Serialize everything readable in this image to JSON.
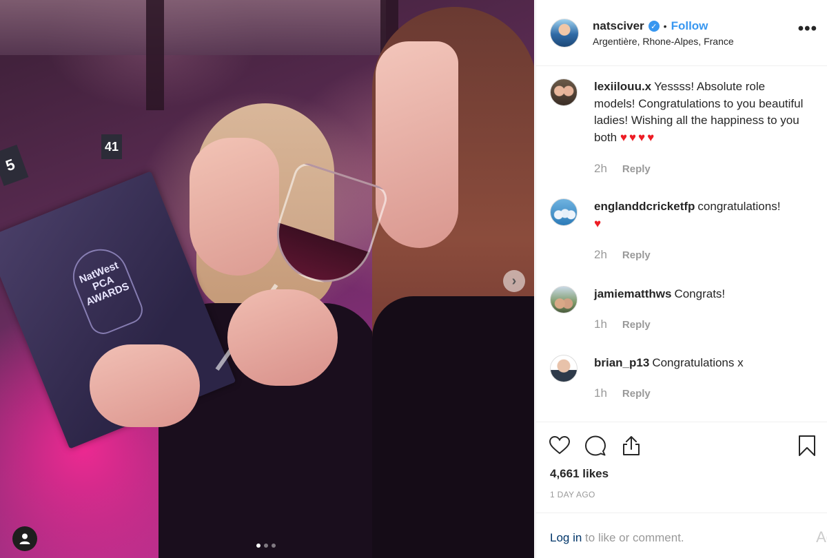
{
  "post": {
    "username": "natsciver",
    "follow_label": "Follow",
    "separator": "•",
    "location": "Argentière, Rhone-Alpes, France",
    "more_label": "•••"
  },
  "photo": {
    "menu_text": "NatWest PCA AWARDS",
    "table_number": "41",
    "table_number_2": "5",
    "next_label": "›",
    "slides": 3,
    "active_slide": 1
  },
  "comments": [
    {
      "username": "lexiilouu.x",
      "text": "Yessss! Absolute role models! Congratulations to you beautiful ladies! Wishing all the happiness to you both",
      "emoji": "♥♥♥♥",
      "time": "2h",
      "reply_label": "Reply"
    },
    {
      "username": "englanddcricketfp",
      "text": "congratulations!",
      "emoji": "♥",
      "time": "2h",
      "reply_label": "Reply"
    },
    {
      "username": "jamiematthws",
      "text": "Congrats!",
      "emoji": "",
      "time": "1h",
      "reply_label": "Reply"
    },
    {
      "username": "brian_p13",
      "text": "Congratulations x",
      "emoji": "",
      "time": "1h",
      "reply_label": "Reply"
    }
  ],
  "engagement": {
    "likes": "4,661 likes",
    "date": "1 DAY AGO"
  },
  "login": {
    "link": "Log in",
    "rest": " to like or comment.",
    "add_comment_fragment": "Ad"
  },
  "icons": {
    "heart": "heart-icon",
    "comment": "comment-icon",
    "share": "share-icon",
    "bookmark": "bookmark-icon",
    "verified": "verified-badge-icon",
    "tag": "user-tag-icon"
  },
  "colors": {
    "link_blue": "#3897f0",
    "heart_red": "#ed1c24",
    "muted": "#999999",
    "login_link": "#003569"
  }
}
